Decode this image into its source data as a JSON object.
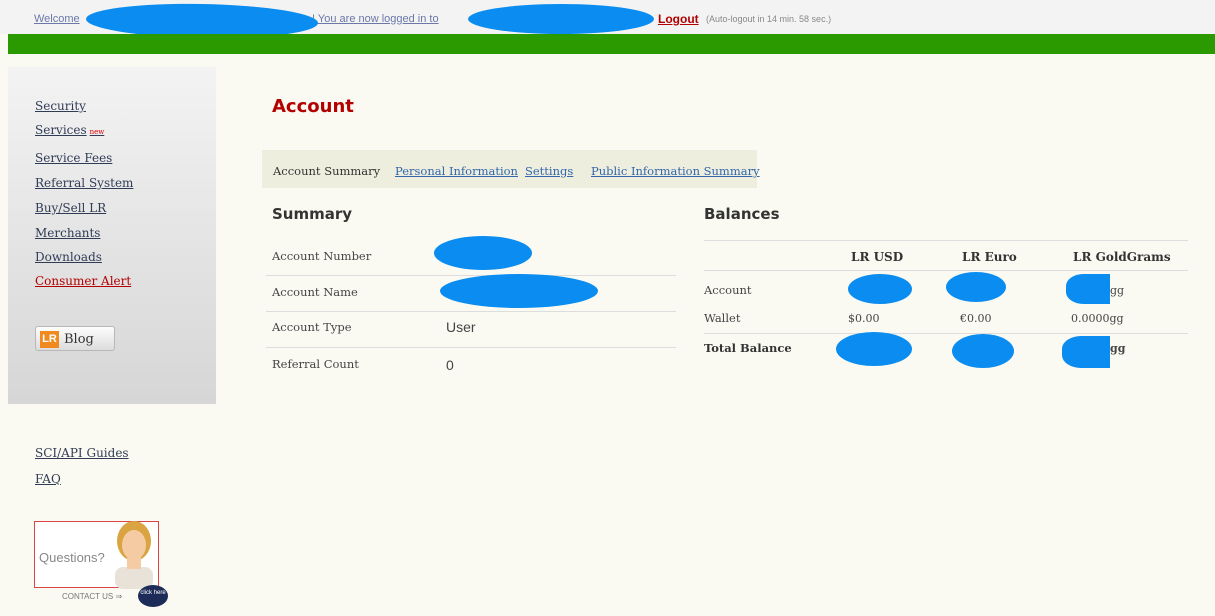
{
  "topbar": {
    "welcome": "Welcome",
    "logged_in": "! You are now logged in to",
    "logout": "Logout",
    "auto_logout": "(Auto-logout in 14 min. 58 sec.)"
  },
  "sidebar": {
    "items": [
      {
        "label": "Security"
      },
      {
        "label": "Services",
        "badge": "new"
      },
      {
        "label": "Service Fees"
      },
      {
        "label": "Referral System"
      },
      {
        "label": "Buy/Sell LR"
      },
      {
        "label": "Merchants"
      },
      {
        "label": "Downloads"
      },
      {
        "label": "Consumer Alert"
      }
    ],
    "blog": {
      "logo": "LR",
      "label": "Blog"
    },
    "bottom_links": [
      "SCI/API Guides",
      "FAQ"
    ],
    "questions": "Questions?",
    "contact_us": "CONTACT US",
    "click_here": "click here"
  },
  "main": {
    "title": "Account",
    "tabs": [
      "Account Summary",
      "Personal Information",
      "Settings",
      "Public Information Summary"
    ],
    "summary": {
      "heading": "Summary",
      "rows": [
        {
          "label": "Account Number",
          "value": ""
        },
        {
          "label": "Account Name",
          "value": ""
        },
        {
          "label": "Account Type",
          "value": "User"
        },
        {
          "label": "Referral Count",
          "value": "0"
        }
      ]
    },
    "balances": {
      "heading": "Balances",
      "columns": [
        "LR USD",
        "LR Euro",
        "LR GoldGrams"
      ],
      "rows": [
        {
          "label": "Account",
          "values": [
            "",
            "",
            "gg"
          ]
        },
        {
          "label": "Wallet",
          "values": [
            "$0.00",
            "€0.00",
            "0.0000gg"
          ]
        },
        {
          "label": "Total Balance",
          "values": [
            "",
            "",
            "gg"
          ]
        }
      ]
    }
  },
  "colors": {
    "green_bar": "#2b9a00",
    "title_red": "#b30000",
    "redaction_blue": "#0a8cf0",
    "link_blue": "#3366aa"
  }
}
